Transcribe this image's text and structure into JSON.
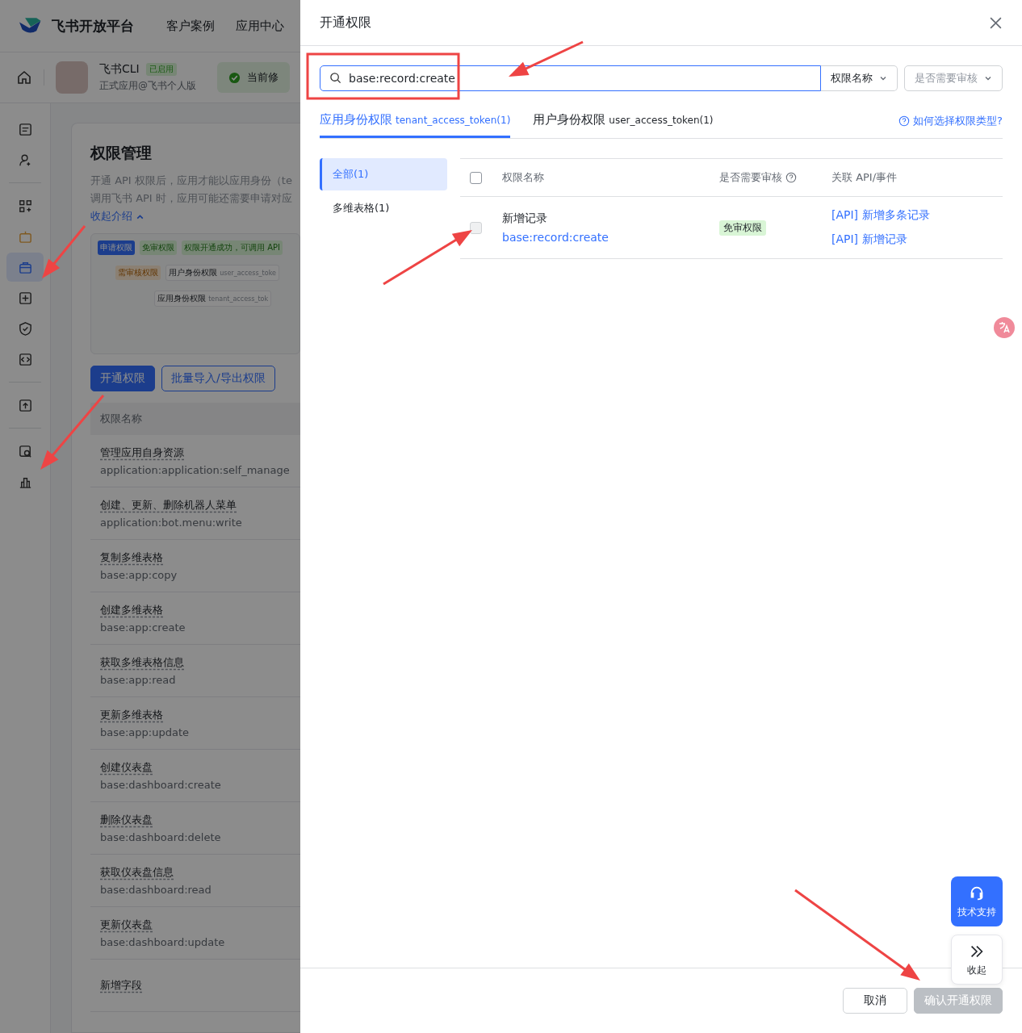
{
  "top_nav": {
    "logo": "飞书开放平台",
    "links": [
      "客户案例",
      "应用中心"
    ]
  },
  "app_header": {
    "name": "飞书CLI",
    "badge": "已启用",
    "subtitle": "正式应用@飞书个人版",
    "notice": "当前修"
  },
  "sidebar_items": [
    {
      "selected": false
    },
    {
      "selected": false
    },
    {
      "selected": false
    },
    {
      "selected": false
    },
    {
      "selected": true
    },
    {
      "selected": false
    },
    {
      "selected": false
    },
    {
      "selected": false
    },
    {
      "selected": false
    },
    {
      "selected": false
    },
    {
      "selected": false
    }
  ],
  "page": {
    "title": "权限管理",
    "intro_lines": [
      "开通 API 权限后，应用才能以应用身份（te",
      "调用飞书 API 时，应用可能还需要申请对应"
    ],
    "collapse_link": "收起介绍",
    "diagram": {
      "start": "申请权限",
      "free": "免审权限",
      "success": "权限开通成功，可调用 API",
      "review": "需审核权限",
      "user_scope": "用户身份权限",
      "user_token": "user_access_toke",
      "app_scope": "应用身份权限",
      "app_token": "tenant_access_tok"
    },
    "buttons": [
      {
        "label": "开通权限",
        "kind": "primary"
      },
      {
        "label": "批量导入/导出权限",
        "kind": "outline"
      }
    ],
    "table": {
      "column": "权限名称",
      "rows": [
        {
          "name": "管理应用自身资源",
          "code": "application:application:self_manage"
        },
        {
          "name": "创建、更新、删除机器人菜单",
          "code": "application:bot.menu:write"
        },
        {
          "name": "复制多维表格",
          "code": "base:app:copy"
        },
        {
          "name": "创建多维表格",
          "code": "base:app:create"
        },
        {
          "name": "获取多维表格信息",
          "code": "base:app:read"
        },
        {
          "name": "更新多维表格",
          "code": "base:app:update"
        },
        {
          "name": "创建仪表盘",
          "code": "base:dashboard:create"
        },
        {
          "name": "删除仪表盘",
          "code": "base:dashboard:delete"
        },
        {
          "name": "获取仪表盘信息",
          "code": "base:dashboard:read"
        },
        {
          "name": "更新仪表盘",
          "code": "base:dashboard:update"
        },
        {
          "name": "新增字段"
        }
      ]
    }
  },
  "drawer": {
    "title": "开通权限",
    "search": {
      "value": "base:record:create"
    },
    "filters": [
      {
        "value": "权限名称",
        "placeholder": false
      },
      {
        "value": "是否需要审核",
        "placeholder": true
      }
    ],
    "tabs": [
      {
        "label": "应用身份权限",
        "token": "tenant_access_token(1)",
        "selected": true
      },
      {
        "label": "用户身份权限",
        "token": "user_access_token(1)",
        "selected": false
      }
    ],
    "help_link": "如何选择权限类型?",
    "categories": [
      {
        "label": "全部(1)",
        "selected": true
      },
      {
        "label": "多维表格(1)",
        "selected": false
      }
    ],
    "select_all": {
      "checked": false
    },
    "columns": [
      "权限名称",
      "是否需要审核",
      "关联 API/事件"
    ],
    "rows": [
      {
        "checked": false,
        "disabled": true,
        "name": "新增记录",
        "code": "base:record:create",
        "review": "免审权限",
        "apis": [
          "[API] 新增多条记录",
          "[API] 新增记录"
        ]
      }
    ],
    "support": "技术支持",
    "collapse": "收起",
    "footer": [
      {
        "label": "取消",
        "disabled": false
      },
      {
        "label": "确认开通权限",
        "disabled": true
      }
    ]
  }
}
